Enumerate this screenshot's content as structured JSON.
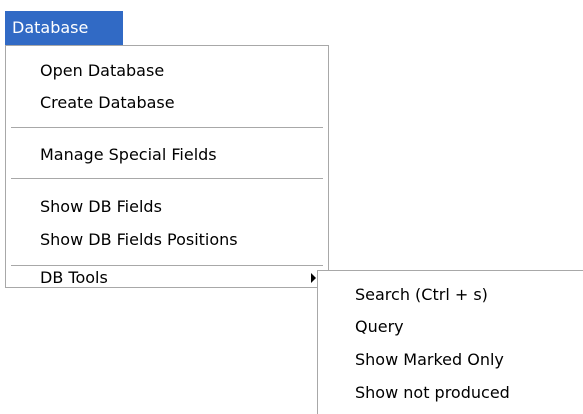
{
  "menubar": {
    "database_label": "Database"
  },
  "database_menu": {
    "open_database": "Open Database",
    "create_database": "Create Database",
    "manage_special_fields": "Manage Special Fields",
    "show_db_fields": "Show DB Fields",
    "show_db_fields_positions": "Show DB Fields Positions",
    "db_tools": "DB Tools"
  },
  "db_tools_submenu": {
    "search": "Search (Ctrl + s)",
    "query": "Query",
    "show_marked_only": "Show Marked Only",
    "show_not_produced": "Show not produced"
  },
  "icons": {
    "submenu_arrow": "chevron-right-icon"
  }
}
